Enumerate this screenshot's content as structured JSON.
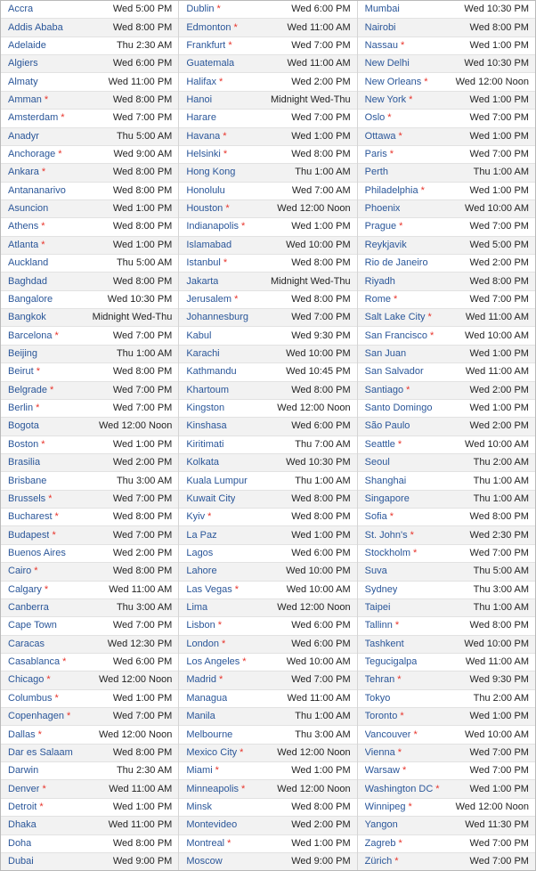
{
  "meta": {
    "dst_marker": "*",
    "accent_city_color": "#2a5699",
    "dst_marker_color": "#e8332a",
    "time_text_color": "#232323",
    "row_alt_background": "#f2f2f2",
    "row_background": "#ffffff"
  },
  "columns": [
    {
      "name": "column-1",
      "rows": [
        {
          "city": "Accra",
          "dst": false,
          "time": "Wed 5:00 PM"
        },
        {
          "city": "Addis Ababa",
          "dst": false,
          "time": "Wed 8:00 PM"
        },
        {
          "city": "Adelaide",
          "dst": false,
          "time": "Thu 2:30 AM"
        },
        {
          "city": "Algiers",
          "dst": false,
          "time": "Wed 6:00 PM"
        },
        {
          "city": "Almaty",
          "dst": false,
          "time": "Wed 11:00 PM"
        },
        {
          "city": "Amman",
          "dst": true,
          "time": "Wed 8:00 PM"
        },
        {
          "city": "Amsterdam",
          "dst": true,
          "time": "Wed 7:00 PM"
        },
        {
          "city": "Anadyr",
          "dst": false,
          "time": "Thu 5:00 AM"
        },
        {
          "city": "Anchorage",
          "dst": true,
          "time": "Wed 9:00 AM"
        },
        {
          "city": "Ankara",
          "dst": true,
          "time": "Wed 8:00 PM"
        },
        {
          "city": "Antananarivo",
          "dst": false,
          "time": "Wed 8:00 PM"
        },
        {
          "city": "Asuncion",
          "dst": false,
          "time": "Wed 1:00 PM"
        },
        {
          "city": "Athens",
          "dst": true,
          "time": "Wed 8:00 PM"
        },
        {
          "city": "Atlanta",
          "dst": true,
          "time": "Wed 1:00 PM"
        },
        {
          "city": "Auckland",
          "dst": false,
          "time": "Thu 5:00 AM"
        },
        {
          "city": "Baghdad",
          "dst": false,
          "time": "Wed 8:00 PM"
        },
        {
          "city": "Bangalore",
          "dst": false,
          "time": "Wed 10:30 PM"
        },
        {
          "city": "Bangkok",
          "dst": false,
          "time": "Midnight Wed-Thu"
        },
        {
          "city": "Barcelona",
          "dst": true,
          "time": "Wed 7:00 PM"
        },
        {
          "city": "Beijing",
          "dst": false,
          "time": "Thu 1:00 AM"
        },
        {
          "city": "Beirut",
          "dst": true,
          "time": "Wed 8:00 PM"
        },
        {
          "city": "Belgrade",
          "dst": true,
          "time": "Wed 7:00 PM"
        },
        {
          "city": "Berlin",
          "dst": true,
          "time": "Wed 7:00 PM"
        },
        {
          "city": "Bogota",
          "dst": false,
          "time": "Wed 12:00 Noon"
        },
        {
          "city": "Boston",
          "dst": true,
          "time": "Wed 1:00 PM"
        },
        {
          "city": "Brasilia",
          "dst": false,
          "time": "Wed 2:00 PM"
        },
        {
          "city": "Brisbane",
          "dst": false,
          "time": "Thu 3:00 AM"
        },
        {
          "city": "Brussels",
          "dst": true,
          "time": "Wed 7:00 PM"
        },
        {
          "city": "Bucharest",
          "dst": true,
          "time": "Wed 8:00 PM"
        },
        {
          "city": "Budapest",
          "dst": true,
          "time": "Wed 7:00 PM"
        },
        {
          "city": "Buenos Aires",
          "dst": false,
          "time": "Wed 2:00 PM"
        },
        {
          "city": "Cairo",
          "dst": true,
          "time": "Wed 8:00 PM"
        },
        {
          "city": "Calgary",
          "dst": true,
          "time": "Wed 11:00 AM"
        },
        {
          "city": "Canberra",
          "dst": false,
          "time": "Thu 3:00 AM"
        },
        {
          "city": "Cape Town",
          "dst": false,
          "time": "Wed 7:00 PM"
        },
        {
          "city": "Caracas",
          "dst": false,
          "time": "Wed 12:30 PM"
        },
        {
          "city": "Casablanca",
          "dst": true,
          "time": "Wed 6:00 PM"
        },
        {
          "city": "Chicago",
          "dst": true,
          "time": "Wed 12:00 Noon"
        },
        {
          "city": "Columbus",
          "dst": true,
          "time": "Wed 1:00 PM"
        },
        {
          "city": "Copenhagen",
          "dst": true,
          "time": "Wed 7:00 PM"
        },
        {
          "city": "Dallas",
          "dst": true,
          "time": "Wed 12:00 Noon"
        },
        {
          "city": "Dar es Salaam",
          "dst": false,
          "time": "Wed 8:00 PM"
        },
        {
          "city": "Darwin",
          "dst": false,
          "time": "Thu 2:30 AM"
        },
        {
          "city": "Denver",
          "dst": true,
          "time": "Wed 11:00 AM"
        },
        {
          "city": "Detroit",
          "dst": true,
          "time": "Wed 1:00 PM"
        },
        {
          "city": "Dhaka",
          "dst": false,
          "time": "Wed 11:00 PM"
        },
        {
          "city": "Doha",
          "dst": false,
          "time": "Wed 8:00 PM"
        },
        {
          "city": "Dubai",
          "dst": false,
          "time": "Wed 9:00 PM"
        }
      ]
    },
    {
      "name": "column-2",
      "rows": [
        {
          "city": "Dublin",
          "dst": true,
          "time": "Wed 6:00 PM"
        },
        {
          "city": "Edmonton",
          "dst": true,
          "time": "Wed 11:00 AM"
        },
        {
          "city": "Frankfurt",
          "dst": true,
          "time": "Wed 7:00 PM"
        },
        {
          "city": "Guatemala",
          "dst": false,
          "time": "Wed 11:00 AM"
        },
        {
          "city": "Halifax",
          "dst": true,
          "time": "Wed 2:00 PM"
        },
        {
          "city": "Hanoi",
          "dst": false,
          "time": "Midnight Wed-Thu"
        },
        {
          "city": "Harare",
          "dst": false,
          "time": "Wed 7:00 PM"
        },
        {
          "city": "Havana",
          "dst": true,
          "time": "Wed 1:00 PM"
        },
        {
          "city": "Helsinki",
          "dst": true,
          "time": "Wed 8:00 PM"
        },
        {
          "city": "Hong Kong",
          "dst": false,
          "time": "Thu 1:00 AM"
        },
        {
          "city": "Honolulu",
          "dst": false,
          "time": "Wed 7:00 AM"
        },
        {
          "city": "Houston",
          "dst": true,
          "time": "Wed 12:00 Noon"
        },
        {
          "city": "Indianapolis",
          "dst": true,
          "time": "Wed 1:00 PM"
        },
        {
          "city": "Islamabad",
          "dst": false,
          "time": "Wed 10:00 PM"
        },
        {
          "city": "Istanbul",
          "dst": true,
          "time": "Wed 8:00 PM"
        },
        {
          "city": "Jakarta",
          "dst": false,
          "time": "Midnight Wed-Thu"
        },
        {
          "city": "Jerusalem",
          "dst": true,
          "time": "Wed 8:00 PM"
        },
        {
          "city": "Johannesburg",
          "dst": false,
          "time": "Wed 7:00 PM"
        },
        {
          "city": "Kabul",
          "dst": false,
          "time": "Wed 9:30 PM"
        },
        {
          "city": "Karachi",
          "dst": false,
          "time": "Wed 10:00 PM"
        },
        {
          "city": "Kathmandu",
          "dst": false,
          "time": "Wed 10:45 PM"
        },
        {
          "city": "Khartoum",
          "dst": false,
          "time": "Wed 8:00 PM"
        },
        {
          "city": "Kingston",
          "dst": false,
          "time": "Wed 12:00 Noon"
        },
        {
          "city": "Kinshasa",
          "dst": false,
          "time": "Wed 6:00 PM"
        },
        {
          "city": "Kiritimati",
          "dst": false,
          "time": "Thu 7:00 AM"
        },
        {
          "city": "Kolkata",
          "dst": false,
          "time": "Wed 10:30 PM"
        },
        {
          "city": "Kuala Lumpur",
          "dst": false,
          "time": "Thu 1:00 AM"
        },
        {
          "city": "Kuwait City",
          "dst": false,
          "time": "Wed 8:00 PM"
        },
        {
          "city": "Kyiv",
          "dst": true,
          "time": "Wed 8:00 PM"
        },
        {
          "city": "La Paz",
          "dst": false,
          "time": "Wed 1:00 PM"
        },
        {
          "city": "Lagos",
          "dst": false,
          "time": "Wed 6:00 PM"
        },
        {
          "city": "Lahore",
          "dst": false,
          "time": "Wed 10:00 PM"
        },
        {
          "city": "Las Vegas",
          "dst": true,
          "time": "Wed 10:00 AM"
        },
        {
          "city": "Lima",
          "dst": false,
          "time": "Wed 12:00 Noon"
        },
        {
          "city": "Lisbon",
          "dst": true,
          "time": "Wed 6:00 PM"
        },
        {
          "city": "London",
          "dst": true,
          "time": "Wed 6:00 PM"
        },
        {
          "city": "Los Angeles",
          "dst": true,
          "time": "Wed 10:00 AM"
        },
        {
          "city": "Madrid",
          "dst": true,
          "time": "Wed 7:00 PM"
        },
        {
          "city": "Managua",
          "dst": false,
          "time": "Wed 11:00 AM"
        },
        {
          "city": "Manila",
          "dst": false,
          "time": "Thu 1:00 AM"
        },
        {
          "city": "Melbourne",
          "dst": false,
          "time": "Thu 3:00 AM"
        },
        {
          "city": "Mexico City",
          "dst": true,
          "time": "Wed 12:00 Noon"
        },
        {
          "city": "Miami",
          "dst": true,
          "time": "Wed 1:00 PM"
        },
        {
          "city": "Minneapolis",
          "dst": true,
          "time": "Wed 12:00 Noon"
        },
        {
          "city": "Minsk",
          "dst": false,
          "time": "Wed 8:00 PM"
        },
        {
          "city": "Montevideo",
          "dst": false,
          "time": "Wed 2:00 PM"
        },
        {
          "city": "Montreal",
          "dst": true,
          "time": "Wed 1:00 PM"
        },
        {
          "city": "Moscow",
          "dst": false,
          "time": "Wed 9:00 PM"
        }
      ]
    },
    {
      "name": "column-3",
      "rows": [
        {
          "city": "Mumbai",
          "dst": false,
          "time": "Wed 10:30 PM"
        },
        {
          "city": "Nairobi",
          "dst": false,
          "time": "Wed 8:00 PM"
        },
        {
          "city": "Nassau",
          "dst": true,
          "time": "Wed 1:00 PM"
        },
        {
          "city": "New Delhi",
          "dst": false,
          "time": "Wed 10:30 PM"
        },
        {
          "city": "New Orleans",
          "dst": true,
          "time": "Wed 12:00 Noon"
        },
        {
          "city": "New York",
          "dst": true,
          "time": "Wed 1:00 PM"
        },
        {
          "city": "Oslo",
          "dst": true,
          "time": "Wed 7:00 PM"
        },
        {
          "city": "Ottawa",
          "dst": true,
          "time": "Wed 1:00 PM"
        },
        {
          "city": "Paris",
          "dst": true,
          "time": "Wed 7:00 PM"
        },
        {
          "city": "Perth",
          "dst": false,
          "time": "Thu 1:00 AM"
        },
        {
          "city": "Philadelphia",
          "dst": true,
          "time": "Wed 1:00 PM"
        },
        {
          "city": "Phoenix",
          "dst": false,
          "time": "Wed 10:00 AM"
        },
        {
          "city": "Prague",
          "dst": true,
          "time": "Wed 7:00 PM"
        },
        {
          "city": "Reykjavik",
          "dst": false,
          "time": "Wed 5:00 PM"
        },
        {
          "city": "Rio de Janeiro",
          "dst": false,
          "time": "Wed 2:00 PM"
        },
        {
          "city": "Riyadh",
          "dst": false,
          "time": "Wed 8:00 PM"
        },
        {
          "city": "Rome",
          "dst": true,
          "time": "Wed 7:00 PM"
        },
        {
          "city": "Salt Lake City",
          "dst": true,
          "time": "Wed 11:00 AM"
        },
        {
          "city": "San Francisco",
          "dst": true,
          "time": "Wed 10:00 AM"
        },
        {
          "city": "San Juan",
          "dst": false,
          "time": "Wed 1:00 PM"
        },
        {
          "city": "San Salvador",
          "dst": false,
          "time": "Wed 11:00 AM"
        },
        {
          "city": "Santiago",
          "dst": true,
          "time": "Wed 2:00 PM"
        },
        {
          "city": "Santo Domingo",
          "dst": false,
          "time": "Wed 1:00 PM"
        },
        {
          "city": "São Paulo",
          "dst": false,
          "time": "Wed 2:00 PM"
        },
        {
          "city": "Seattle",
          "dst": true,
          "time": "Wed 10:00 AM"
        },
        {
          "city": "Seoul",
          "dst": false,
          "time": "Thu 2:00 AM"
        },
        {
          "city": "Shanghai",
          "dst": false,
          "time": "Thu 1:00 AM"
        },
        {
          "city": "Singapore",
          "dst": false,
          "time": "Thu 1:00 AM"
        },
        {
          "city": "Sofia",
          "dst": true,
          "time": "Wed 8:00 PM"
        },
        {
          "city": "St. John's",
          "dst": true,
          "time": "Wed 2:30 PM"
        },
        {
          "city": "Stockholm",
          "dst": true,
          "time": "Wed 7:00 PM"
        },
        {
          "city": "Suva",
          "dst": false,
          "time": "Thu 5:00 AM"
        },
        {
          "city": "Sydney",
          "dst": false,
          "time": "Thu 3:00 AM"
        },
        {
          "city": "Taipei",
          "dst": false,
          "time": "Thu 1:00 AM"
        },
        {
          "city": "Tallinn",
          "dst": true,
          "time": "Wed 8:00 PM"
        },
        {
          "city": "Tashkent",
          "dst": false,
          "time": "Wed 10:00 PM"
        },
        {
          "city": "Tegucigalpa",
          "dst": false,
          "time": "Wed 11:00 AM"
        },
        {
          "city": "Tehran",
          "dst": true,
          "time": "Wed 9:30 PM"
        },
        {
          "city": "Tokyo",
          "dst": false,
          "time": "Thu 2:00 AM"
        },
        {
          "city": "Toronto",
          "dst": true,
          "time": "Wed 1:00 PM"
        },
        {
          "city": "Vancouver",
          "dst": true,
          "time": "Wed 10:00 AM"
        },
        {
          "city": "Vienna",
          "dst": true,
          "time": "Wed 7:00 PM"
        },
        {
          "city": "Warsaw",
          "dst": true,
          "time": "Wed 7:00 PM"
        },
        {
          "city": "Washington DC",
          "dst": true,
          "time": "Wed 1:00 PM"
        },
        {
          "city": "Winnipeg",
          "dst": true,
          "time": "Wed 12:00 Noon"
        },
        {
          "city": "Yangon",
          "dst": false,
          "time": "Wed 11:30 PM"
        },
        {
          "city": "Zagreb",
          "dst": true,
          "time": "Wed 7:00 PM"
        },
        {
          "city": "Zürich",
          "dst": true,
          "time": "Wed 7:00 PM"
        }
      ]
    }
  ]
}
